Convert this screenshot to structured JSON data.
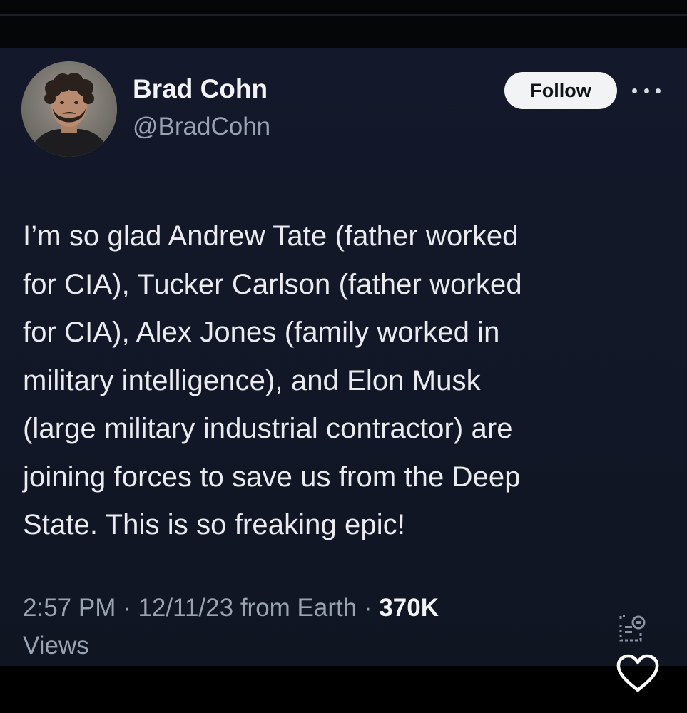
{
  "post": {
    "author": {
      "display_name": "Brad Cohn",
      "handle": "@BradCohn"
    },
    "follow_label": "Follow",
    "text": "I’m so glad Andrew Tate (father worked\nfor CIA), Tucker Carlson (father worked\nfor CIA), Alex Jones (family worked in\nmilitary intelligence),  and Elon Musk\n(large military industrial contractor) are\njoining forces to save us from the Deep\nState.  This is so freaking epic!",
    "meta": {
      "time_date": "2:57 PM · 12/11/23 from Earth · ",
      "views_count": "370K",
      "views_label": "Views"
    }
  },
  "icons": {
    "more": "more-options-icon",
    "analytics": "analytics-icon",
    "like": "heart-icon"
  },
  "colors": {
    "card_background": "#111827",
    "text_primary": "#e9ebee",
    "text_secondary": "#9aa3b2",
    "follow_button_bg": "#f2f3f5",
    "follow_button_text": "#0f1419"
  }
}
